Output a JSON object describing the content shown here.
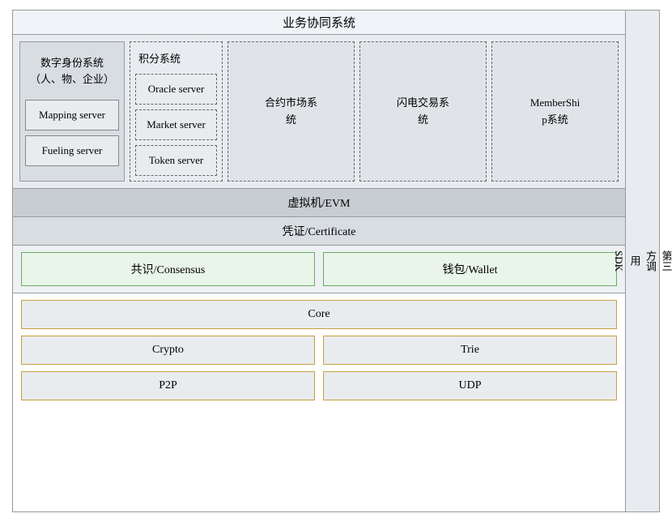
{
  "header": {
    "biz_title": "业务协同系统"
  },
  "top": {
    "digital_identity": "数字身份系统\n（人、物、企业）",
    "mapping_server": "Mapping server",
    "fueling_server": "Fueling server",
    "jifenxi_label": "积分系统",
    "oracle_server": "Oracle server",
    "market_server": "Market server",
    "token_server": "Token server",
    "contract_market": "合约市场系\n统",
    "flash_trade": "闪电交易系\n统",
    "membership": "MemberShi\np系统"
  },
  "evm": {
    "label": "虚拟机/EVM"
  },
  "cert": {
    "label": "凭证/Certificate"
  },
  "consensus": {
    "label": "共识/Consensus"
  },
  "wallet": {
    "label": "钱包/Wallet"
  },
  "core": {
    "label": "Core"
  },
  "crypto": {
    "label": "Crypto"
  },
  "trie": {
    "label": "Trie"
  },
  "p2p": {
    "label": "P2P"
  },
  "udp": {
    "label": "UDP"
  },
  "sdk": {
    "label": "第三方调用SDK"
  }
}
